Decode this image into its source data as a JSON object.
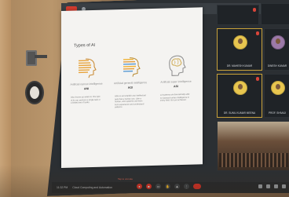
{
  "slide": {
    "title": "Types of AI",
    "types": [
      {
        "name": "Artificial narrow intelligence",
        "abbr": "ANI",
        "description": "Also known as weak AI, this type of AI can perform a single task or a limited set of tasks.",
        "color": "#e8a33a"
      },
      {
        "name": "Artificial general intelligence",
        "abbr": "AGI",
        "description": "Able to accomplish any intellectual task that a human can. Like a human, AGI systems can learn from experience and understand patterns.",
        "color": "#f0b233"
      },
      {
        "name": "Artificial super intelligence",
        "abbr": "ASI",
        "description": "AI systems are theoretically able to surpass human intelligence in every field. Not yet achieved.",
        "color": "#d4b56a"
      }
    ]
  },
  "participants": [
    {
      "name": "",
      "muted": true,
      "highlight": false
    },
    {
      "name": "",
      "muted": true,
      "highlight": false
    },
    {
      "name": "DR. MAHESH KUMAR",
      "muted": true,
      "highlight": true
    },
    {
      "name": "DINESH KUMAR",
      "muted": false,
      "highlight": false
    },
    {
      "name": "DR. SUNIL KUMAR MEENA",
      "muted": true,
      "highlight": true
    },
    {
      "name": "PROF. SHIVAJI",
      "muted": true,
      "highlight": false
    }
  ],
  "meeting": {
    "time": "11:32 PM",
    "title": "Cloud Computing and Automation",
    "camera_label": "Tap to unmute"
  },
  "colors": {
    "record": "#d23b2e",
    "end_call": "#d93025",
    "avatar": "#e8c64f"
  }
}
